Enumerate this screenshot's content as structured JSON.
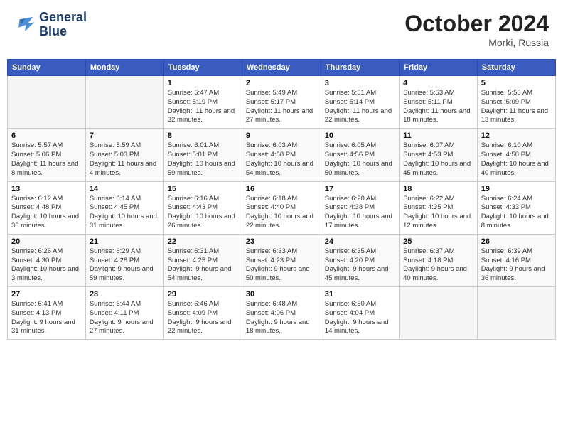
{
  "header": {
    "logo_line1": "General",
    "logo_line2": "Blue",
    "month": "October 2024",
    "location": "Morki, Russia"
  },
  "weekdays": [
    "Sunday",
    "Monday",
    "Tuesday",
    "Wednesday",
    "Thursday",
    "Friday",
    "Saturday"
  ],
  "weeks": [
    [
      {
        "day": "",
        "empty": true
      },
      {
        "day": "",
        "empty": true
      },
      {
        "day": "1",
        "sunrise": "5:47 AM",
        "sunset": "5:19 PM",
        "daylight": "11 hours and 32 minutes."
      },
      {
        "day": "2",
        "sunrise": "5:49 AM",
        "sunset": "5:17 PM",
        "daylight": "11 hours and 27 minutes."
      },
      {
        "day": "3",
        "sunrise": "5:51 AM",
        "sunset": "5:14 PM",
        "daylight": "11 hours and 22 minutes."
      },
      {
        "day": "4",
        "sunrise": "5:53 AM",
        "sunset": "5:11 PM",
        "daylight": "11 hours and 18 minutes."
      },
      {
        "day": "5",
        "sunrise": "5:55 AM",
        "sunset": "5:09 PM",
        "daylight": "11 hours and 13 minutes."
      }
    ],
    [
      {
        "day": "6",
        "sunrise": "5:57 AM",
        "sunset": "5:06 PM",
        "daylight": "11 hours and 8 minutes."
      },
      {
        "day": "7",
        "sunrise": "5:59 AM",
        "sunset": "5:03 PM",
        "daylight": "11 hours and 4 minutes."
      },
      {
        "day": "8",
        "sunrise": "6:01 AM",
        "sunset": "5:01 PM",
        "daylight": "10 hours and 59 minutes."
      },
      {
        "day": "9",
        "sunrise": "6:03 AM",
        "sunset": "4:58 PM",
        "daylight": "10 hours and 54 minutes."
      },
      {
        "day": "10",
        "sunrise": "6:05 AM",
        "sunset": "4:56 PM",
        "daylight": "10 hours and 50 minutes."
      },
      {
        "day": "11",
        "sunrise": "6:07 AM",
        "sunset": "4:53 PM",
        "daylight": "10 hours and 45 minutes."
      },
      {
        "day": "12",
        "sunrise": "6:10 AM",
        "sunset": "4:50 PM",
        "daylight": "10 hours and 40 minutes."
      }
    ],
    [
      {
        "day": "13",
        "sunrise": "6:12 AM",
        "sunset": "4:48 PM",
        "daylight": "10 hours and 36 minutes."
      },
      {
        "day": "14",
        "sunrise": "6:14 AM",
        "sunset": "4:45 PM",
        "daylight": "10 hours and 31 minutes."
      },
      {
        "day": "15",
        "sunrise": "6:16 AM",
        "sunset": "4:43 PM",
        "daylight": "10 hours and 26 minutes."
      },
      {
        "day": "16",
        "sunrise": "6:18 AM",
        "sunset": "4:40 PM",
        "daylight": "10 hours and 22 minutes."
      },
      {
        "day": "17",
        "sunrise": "6:20 AM",
        "sunset": "4:38 PM",
        "daylight": "10 hours and 17 minutes."
      },
      {
        "day": "18",
        "sunrise": "6:22 AM",
        "sunset": "4:35 PM",
        "daylight": "10 hours and 12 minutes."
      },
      {
        "day": "19",
        "sunrise": "6:24 AM",
        "sunset": "4:33 PM",
        "daylight": "10 hours and 8 minutes."
      }
    ],
    [
      {
        "day": "20",
        "sunrise": "6:26 AM",
        "sunset": "4:30 PM",
        "daylight": "10 hours and 3 minutes."
      },
      {
        "day": "21",
        "sunrise": "6:29 AM",
        "sunset": "4:28 PM",
        "daylight": "9 hours and 59 minutes."
      },
      {
        "day": "22",
        "sunrise": "6:31 AM",
        "sunset": "4:25 PM",
        "daylight": "9 hours and 54 minutes."
      },
      {
        "day": "23",
        "sunrise": "6:33 AM",
        "sunset": "4:23 PM",
        "daylight": "9 hours and 50 minutes."
      },
      {
        "day": "24",
        "sunrise": "6:35 AM",
        "sunset": "4:20 PM",
        "daylight": "9 hours and 45 minutes."
      },
      {
        "day": "25",
        "sunrise": "6:37 AM",
        "sunset": "4:18 PM",
        "daylight": "9 hours and 40 minutes."
      },
      {
        "day": "26",
        "sunrise": "6:39 AM",
        "sunset": "4:16 PM",
        "daylight": "9 hours and 36 minutes."
      }
    ],
    [
      {
        "day": "27",
        "sunrise": "6:41 AM",
        "sunset": "4:13 PM",
        "daylight": "9 hours and 31 minutes."
      },
      {
        "day": "28",
        "sunrise": "6:44 AM",
        "sunset": "4:11 PM",
        "daylight": "9 hours and 27 minutes."
      },
      {
        "day": "29",
        "sunrise": "6:46 AM",
        "sunset": "4:09 PM",
        "daylight": "9 hours and 22 minutes."
      },
      {
        "day": "30",
        "sunrise": "6:48 AM",
        "sunset": "4:06 PM",
        "daylight": "9 hours and 18 minutes."
      },
      {
        "day": "31",
        "sunrise": "6:50 AM",
        "sunset": "4:04 PM",
        "daylight": "9 hours and 14 minutes."
      },
      {
        "day": "",
        "empty": true
      },
      {
        "day": "",
        "empty": true
      }
    ]
  ]
}
